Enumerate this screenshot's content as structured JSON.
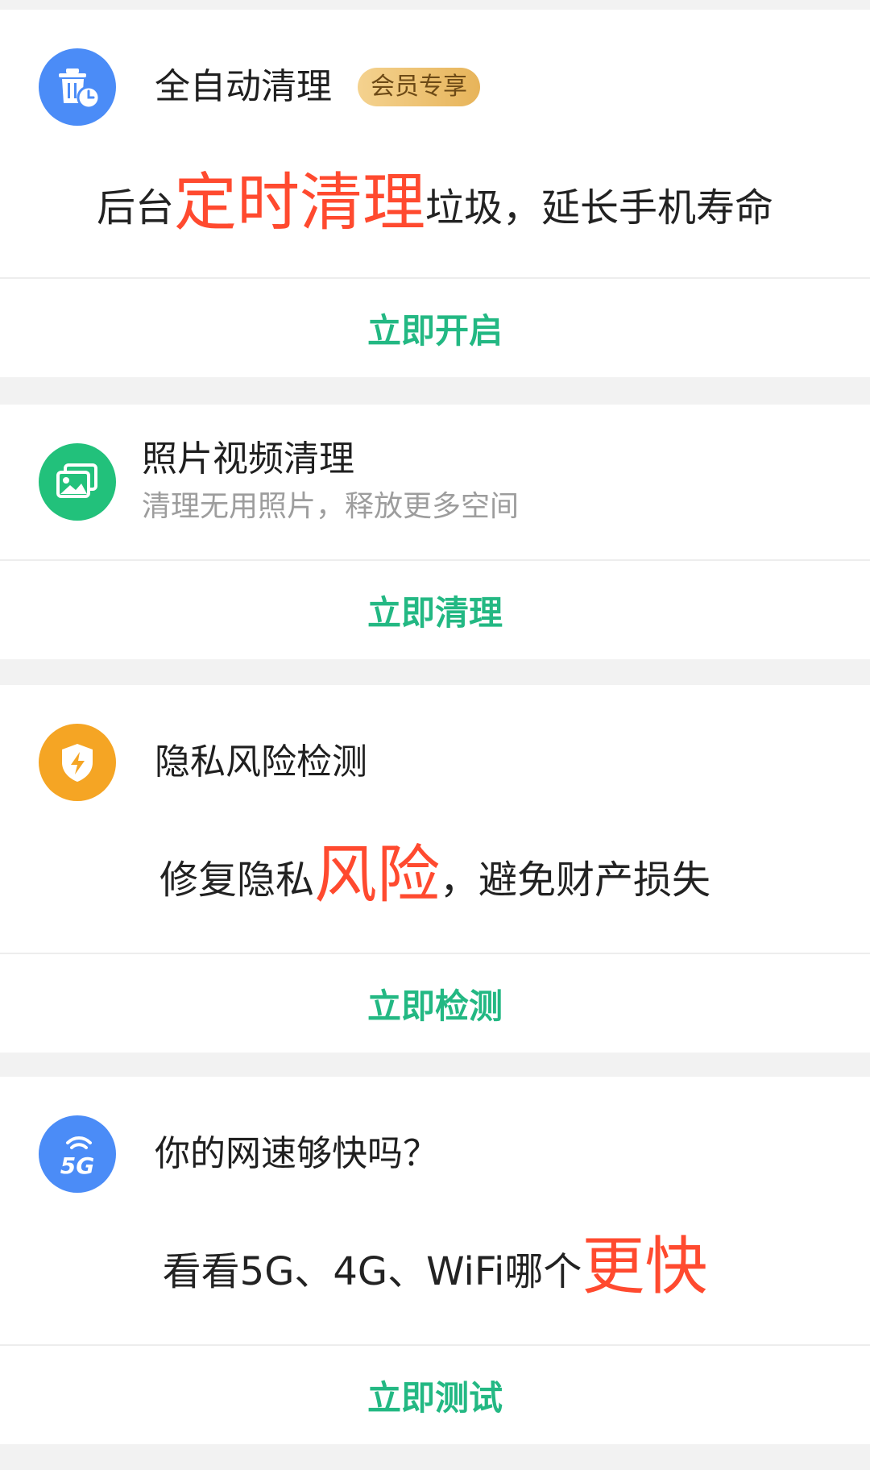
{
  "cards": [
    {
      "icon": "trash-clock-icon",
      "title": "全自动清理",
      "badge": "会员专享",
      "hero": {
        "prefix": "后台",
        "highlight": "定时清理",
        "suffix": "垃圾，延长手机寿命"
      },
      "action": "立即开启",
      "icon_color": "#4b8cf7"
    },
    {
      "icon": "photo-icon",
      "title": "照片视频清理",
      "subtitle": "清理无用照片，释放更多空间",
      "action": "立即清理",
      "icon_color": "#22c17b"
    },
    {
      "icon": "shield-bolt-icon",
      "title": "隐私风险检测",
      "hero": {
        "prefix": "修复隐私",
        "highlight": "风险",
        "suffix": "，避免财产损失"
      },
      "action": "立即检测",
      "icon_color": "#f5a524"
    },
    {
      "icon": "5g-icon",
      "title": "你的网速够快吗？",
      "hero": {
        "prefix": "看看5G、4G、WiFi哪个",
        "highlight": "更快",
        "suffix": ""
      },
      "action": "立即测试",
      "icon_color": "#4b8cf7"
    }
  ],
  "colors": {
    "accent_green": "#23b883",
    "highlight_red": "#ff4a2f",
    "page_bg": "#f2f2f2",
    "card_bg": "#ffffff"
  }
}
